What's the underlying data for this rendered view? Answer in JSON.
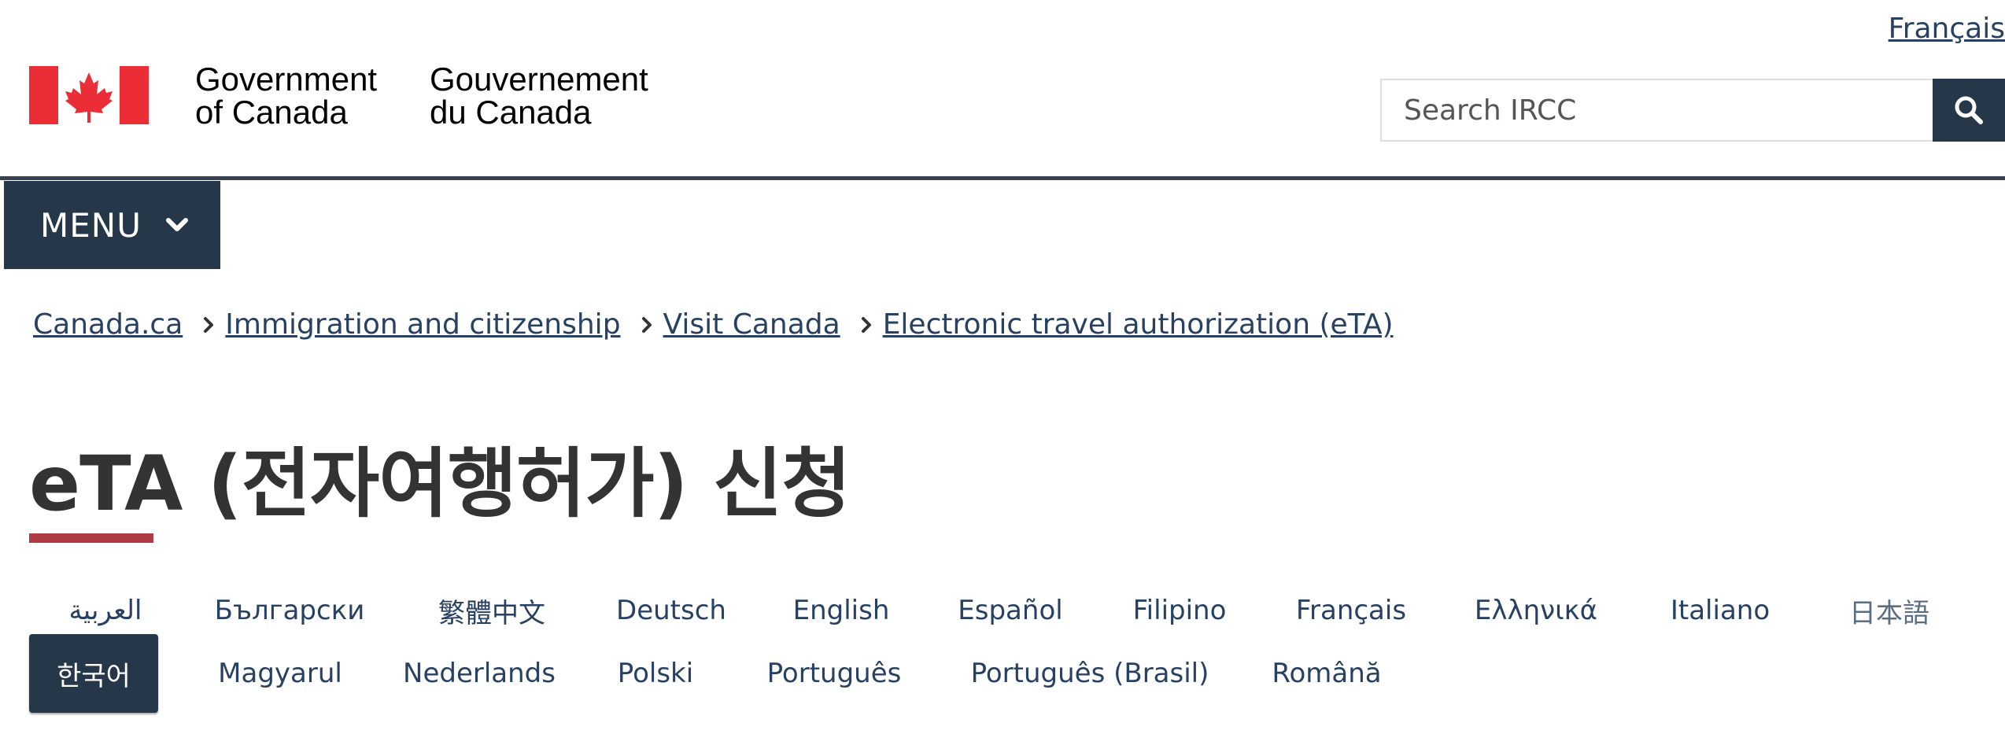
{
  "header": {
    "language_toggle": "Français",
    "signature_en_line1": "Government",
    "signature_en_line2": "of Canada",
    "signature_fr_line1": "Gouvernement",
    "signature_fr_line2": "du Canada",
    "flag_icon": "canada-flag-icon",
    "search": {
      "placeholder": "Search IRCC",
      "value": "",
      "button_icon": "search-icon"
    }
  },
  "menu": {
    "label": "MENU",
    "icon": "chevron-down-icon"
  },
  "breadcrumb": [
    "Canada.ca",
    "Immigration and citizenship",
    "Visit Canada",
    "Electronic travel authorization (eTA)"
  ],
  "page_title": "eTA (전자여행허가) 신청",
  "languages": {
    "row1": [
      "العربية",
      "Български",
      "繁體中文",
      "Deutsch",
      "English",
      "Español",
      "Filipino",
      "Français",
      "Ελληνικά",
      "Italiano",
      "日本語"
    ],
    "row2": [
      "한국어",
      "Magyarul",
      "Nederlands",
      "Polski",
      "Português",
      "Português (Brasil)",
      "Română"
    ],
    "current": "한국어"
  },
  "colors": {
    "brand_navy": "#26374a",
    "link": "#284162",
    "title_accent": "#af3c43",
    "flag_red": "#eb2d37"
  }
}
